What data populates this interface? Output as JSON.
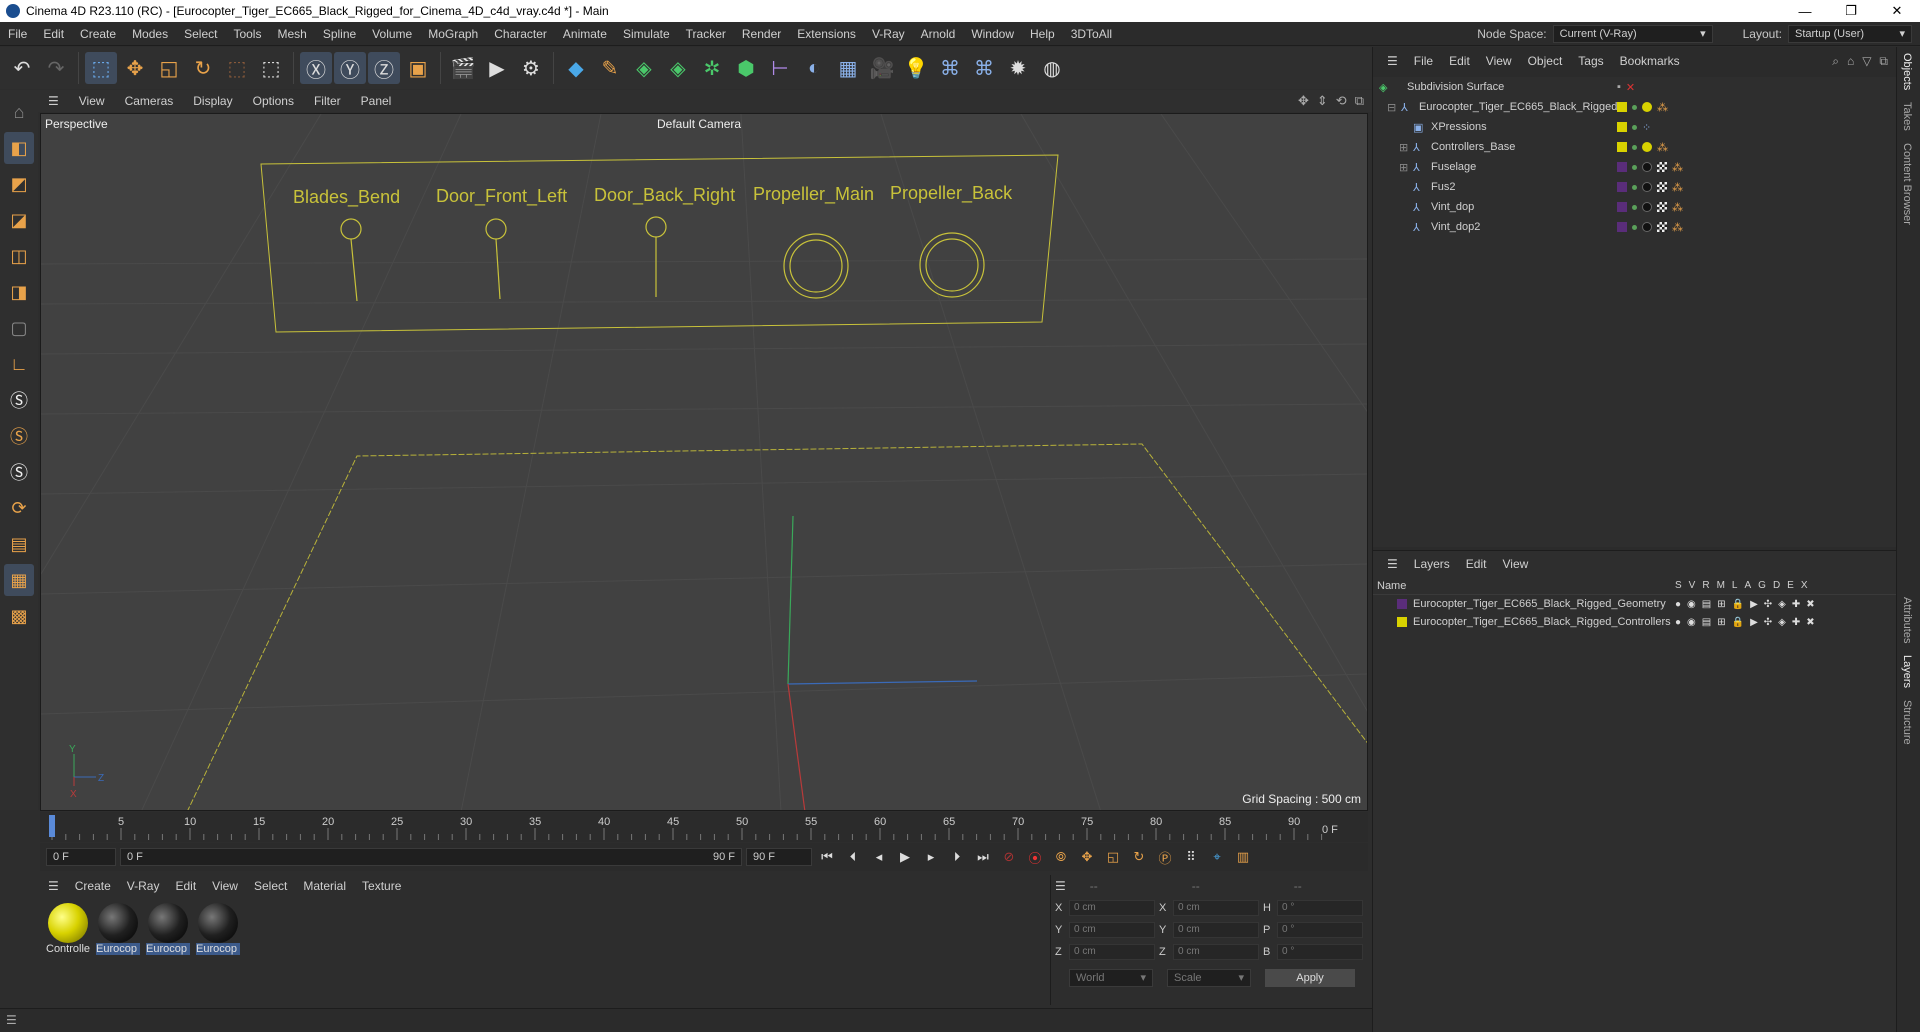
{
  "window": {
    "title": "Cinema 4D R23.110 (RC) - [Eurocopter_Tiger_EC665_Black_Rigged_for_Cinema_4D_c4d_vray.c4d *] - Main",
    "controls": [
      "—",
      "❐",
      "✕"
    ]
  },
  "menubar": {
    "items": [
      "File",
      "Edit",
      "Create",
      "Modes",
      "Select",
      "Tools",
      "Mesh",
      "Spline",
      "Volume",
      "MoGraph",
      "Character",
      "Animate",
      "Simulate",
      "Tracker",
      "Render",
      "Extensions",
      "V-Ray",
      "Arnold",
      "Window",
      "Help",
      "3DToAll"
    ],
    "node_space_label": "Node Space:",
    "node_space_value": "Current (V-Ray)",
    "layout_label": "Layout:",
    "layout_value": "Startup (User)"
  },
  "viewport": {
    "menu": [
      "View",
      "Cameras",
      "Display",
      "Options",
      "Filter",
      "Panel"
    ],
    "view_name": "Perspective",
    "camera": "Default Camera",
    "grid_spacing": "Grid Spacing : 500 cm",
    "controller_labels": [
      "Blades_Bend",
      "Door_Front_Left",
      "Door_Back_Right",
      "Propeller_Main",
      "Propeller_Back"
    ],
    "axis_labels": [
      "Y",
      "Z",
      "X"
    ]
  },
  "timeline": {
    "ticks": [
      "0",
      "5",
      "10",
      "15",
      "20",
      "25",
      "30",
      "35",
      "40",
      "45",
      "50",
      "55",
      "60",
      "65",
      "70",
      "75",
      "80",
      "85",
      "90"
    ],
    "current_frame": "0 F",
    "start_frame": "0 F",
    "range_start": "0 F",
    "range_end": "90 F",
    "end_frame": "90 F",
    "end_field": "0 F"
  },
  "material_manager": {
    "menu": [
      "Create",
      "V-Ray",
      "Edit",
      "View",
      "Select",
      "Material",
      "Texture"
    ],
    "materials": [
      {
        "label": "Controlle",
        "color": "#d8d200"
      },
      {
        "label": "Eurocop",
        "color": "#202020"
      },
      {
        "label": "Eurocop",
        "color": "#202020"
      },
      {
        "label": "Eurocop",
        "color": "#202020"
      }
    ]
  },
  "attributes": {
    "headers": [
      "--",
      "--",
      "--"
    ],
    "rows": [
      {
        "a": "X",
        "av": "0 cm",
        "b": "X",
        "bv": "0 cm",
        "c": "H",
        "cv": "0 °"
      },
      {
        "a": "Y",
        "av": "0 cm",
        "b": "Y",
        "bv": "0 cm",
        "c": "P",
        "cv": "0 °"
      },
      {
        "a": "Z",
        "av": "0 cm",
        "b": "Z",
        "bv": "0 cm",
        "c": "B",
        "cv": "0 °"
      }
    ],
    "coord_mode": "World",
    "scale_mode": "Scale",
    "apply": "Apply"
  },
  "objects": {
    "menu": [
      "File",
      "Edit",
      "View",
      "Object",
      "Tags",
      "Bookmarks"
    ],
    "rows": [
      {
        "name": "Subdivision Surface",
        "indent": 0,
        "color": ""
      },
      {
        "name": "Eurocopter_Tiger_EC665_Black_Rigged",
        "indent": 1,
        "color": "#d8d200"
      },
      {
        "name": "XPressions",
        "indent": 2,
        "color": "#d8d200"
      },
      {
        "name": "Controllers_Base",
        "indent": 2,
        "color": "#d8d200"
      },
      {
        "name": "Fuselage",
        "indent": 2,
        "color": "#5a2d7a"
      },
      {
        "name": "Fus2",
        "indent": 2,
        "color": "#5a2d7a"
      },
      {
        "name": "Vint_dop",
        "indent": 2,
        "color": "#5a2d7a"
      },
      {
        "name": "Vint_dop2",
        "indent": 2,
        "color": "#5a2d7a"
      }
    ]
  },
  "layers": {
    "menu": [
      "Layers",
      "Edit",
      "View"
    ],
    "header_name": "Name",
    "header_cols": [
      "S",
      "V",
      "R",
      "M",
      "L",
      "A",
      "G",
      "D",
      "E",
      "X"
    ],
    "rows": [
      {
        "name": "Eurocopter_Tiger_EC665_Black_Rigged_Geometry",
        "color": "#5a2d7a"
      },
      {
        "name": "Eurocopter_Tiger_EC665_Black_Rigged_Controllers",
        "color": "#d8d200"
      }
    ]
  },
  "side_tabs": [
    "Objects",
    "Takes",
    "Content Browser",
    "Attributes",
    "Layers",
    "Structure"
  ],
  "colors": {
    "accent": "#3f4b5c",
    "controller": "#c8c23a",
    "viewport_bg": "#414141"
  }
}
